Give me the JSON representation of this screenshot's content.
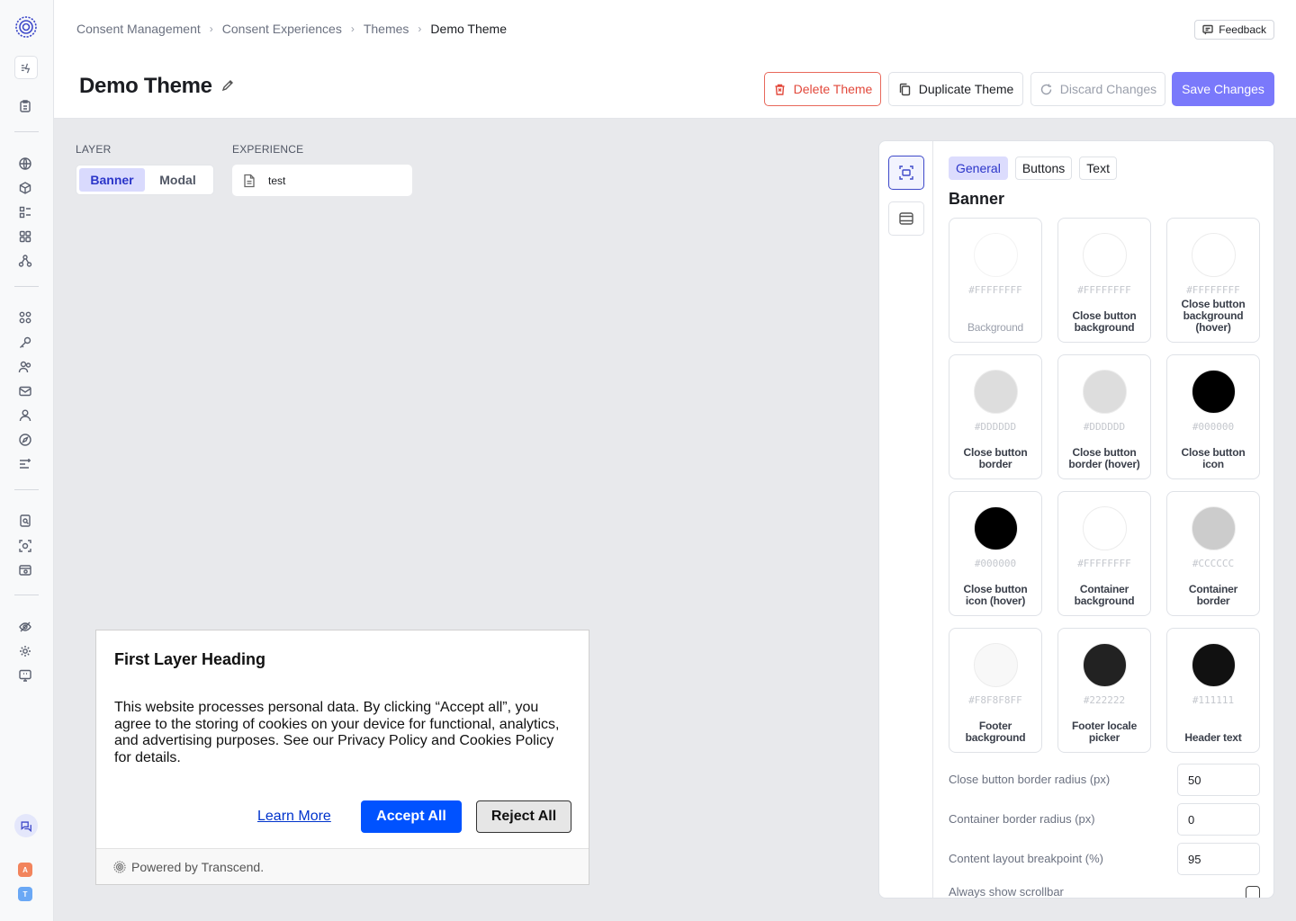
{
  "breadcrumb": {
    "items": [
      "Consent Management",
      "Consent Experiences",
      "Themes"
    ],
    "current": "Demo Theme"
  },
  "feedback_label": "Feedback",
  "page_title": "Demo Theme",
  "actions": {
    "delete": "Delete Theme",
    "duplicate": "Duplicate Theme",
    "discard": "Discard Changes",
    "save": "Save Changes"
  },
  "layer": {
    "label": "LAYER",
    "options": [
      "Banner",
      "Modal"
    ],
    "selected": "Banner"
  },
  "experience": {
    "label": "EXPERIENCE",
    "value": "test"
  },
  "preview": {
    "heading": "First Layer Heading",
    "body": "This website processes personal data. By clicking “Accept all”, you agree to the storing of cookies on your device for functional, analytics, and advertising purposes. See our Privacy Policy and Cookies Policy for details.",
    "learn_more": "Learn More",
    "accept": "Accept All",
    "reject": "Reject All",
    "footer": "Powered by Transcend."
  },
  "panel": {
    "tabs": [
      "General",
      "Buttons",
      "Text"
    ],
    "active_tab": "General",
    "section_title": "Banner",
    "colors": [
      {
        "hex": "#FFFFFFFF",
        "label": "Background",
        "color": "#FFFFFF",
        "disabled": true
      },
      {
        "hex": "#FFFFFFFF",
        "label": "Close button background",
        "color": "#FFFFFF"
      },
      {
        "hex": "#FFFFFFFF",
        "label": "Close button background (hover)",
        "color": "#FFFFFF"
      },
      {
        "hex": "#DDDDDD",
        "label": "Close button border",
        "color": "#DDDDDD"
      },
      {
        "hex": "#DDDDDD",
        "label": "Close button border (hover)",
        "color": "#DDDDDD"
      },
      {
        "hex": "#000000",
        "label": "Close button icon",
        "color": "#000000"
      },
      {
        "hex": "#000000",
        "label": "Close button icon (hover)",
        "color": "#000000"
      },
      {
        "hex": "#FFFFFFFF",
        "label": "Container background",
        "color": "#FFFFFF"
      },
      {
        "hex": "#CCCCCC",
        "label": "Container border",
        "color": "#CCCCCC"
      },
      {
        "hex": "#F8F8F8FF",
        "label": "Footer background",
        "color": "#F8F8F8"
      },
      {
        "hex": "#222222",
        "label": "Footer locale picker",
        "color": "#222222"
      },
      {
        "hex": "#111111",
        "label": "Header text",
        "color": "#111111"
      }
    ],
    "fields": [
      {
        "label": "Close button border radius (px)",
        "value": "50"
      },
      {
        "label": "Container border radius (px)",
        "value": "0"
      },
      {
        "label": "Content layout breakpoint (%)",
        "value": "95"
      }
    ],
    "scrollbar_label": "Always show scrollbar",
    "scrollbar_checked": false
  },
  "sidebar": {
    "avatars": [
      {
        "letter": "A",
        "color": "#f2845c"
      },
      {
        "letter": "T",
        "color": "#6aa8f5"
      }
    ]
  },
  "colors": {
    "accent": "#7a79fb",
    "danger": "#e2483b",
    "banner_accept": "#0052ff"
  }
}
